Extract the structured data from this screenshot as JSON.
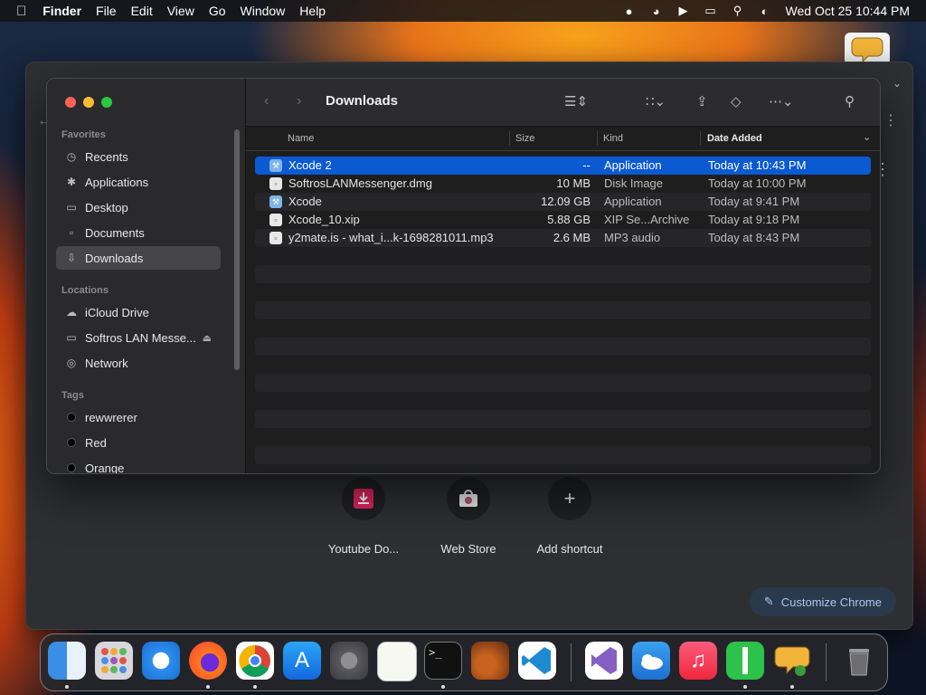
{
  "menubar": {
    "apple": "",
    "app": "Finder",
    "items": [
      "File",
      "Edit",
      "View",
      "Go",
      "Window",
      "Help"
    ],
    "clock": "Wed Oct 25  10:44 PM"
  },
  "chrome": {
    "shortcuts": [
      {
        "label": "Youtube Do...",
        "icon": "download-icon"
      },
      {
        "label": "Web Store",
        "icon": "web-store-icon"
      },
      {
        "label": "Add shortcut",
        "icon": "plus-icon"
      }
    ],
    "customize_label": "Customize Chrome"
  },
  "finder": {
    "title": "Downloads",
    "sidebar": {
      "favorites_header": "Favorites",
      "favorites": [
        {
          "label": "Recents",
          "icon": "clock-icon"
        },
        {
          "label": "Applications",
          "icon": "applications-icon"
        },
        {
          "label": "Desktop",
          "icon": "desktop-icon"
        },
        {
          "label": "Documents",
          "icon": "document-icon"
        },
        {
          "label": "Downloads",
          "icon": "download-circle-icon",
          "selected": true
        }
      ],
      "locations_header": "Locations",
      "locations": [
        {
          "label": "iCloud Drive",
          "icon": "cloud-icon"
        },
        {
          "label": "Softros LAN Messe...",
          "icon": "drive-icon"
        },
        {
          "label": "Network",
          "icon": "globe-icon"
        }
      ],
      "tags_header": "Tags",
      "tags": [
        {
          "label": "rewwrerer"
        },
        {
          "label": "Red"
        },
        {
          "label": "Orange"
        }
      ]
    },
    "columns": {
      "name": "Name",
      "size": "Size",
      "kind": "Kind",
      "date": "Date Added"
    },
    "files": [
      {
        "name": "Xcode 2",
        "size": "--",
        "kind": "Application",
        "date": "Today at 10:43 PM",
        "icon": "xcode-icon",
        "selected": true
      },
      {
        "name": "SoftrosLANMessenger.dmg",
        "size": "10 MB",
        "kind": "Disk Image",
        "date": "Today at 10:00 PM",
        "icon": "file-icon"
      },
      {
        "name": "Xcode",
        "size": "12.09 GB",
        "kind": "Application",
        "date": "Today at 9:41 PM",
        "icon": "xcode-icon"
      },
      {
        "name": "Xcode_10.xip",
        "size": "5.88 GB",
        "kind": "XIP Se...Archive",
        "date": "Today at 9:18 PM",
        "icon": "file-icon"
      },
      {
        "name": "y2mate.is - what_i...k-1698281011.mp3",
        "size": "2.6 MB",
        "kind": "MP3 audio",
        "date": "Today at 8:43 PM",
        "icon": "file-icon"
      }
    ]
  },
  "dock": {
    "apps": [
      "Finder",
      "Launchpad",
      "Safari",
      "Firefox",
      "Chrome",
      "App Store",
      "System Settings",
      "TextEdit",
      "Terminal",
      "GarageBand",
      "Visual Studio Code",
      "Visual Studio",
      "Weather",
      "Music",
      "Numbers",
      "Softros LAN Messenger",
      "Trash"
    ]
  }
}
